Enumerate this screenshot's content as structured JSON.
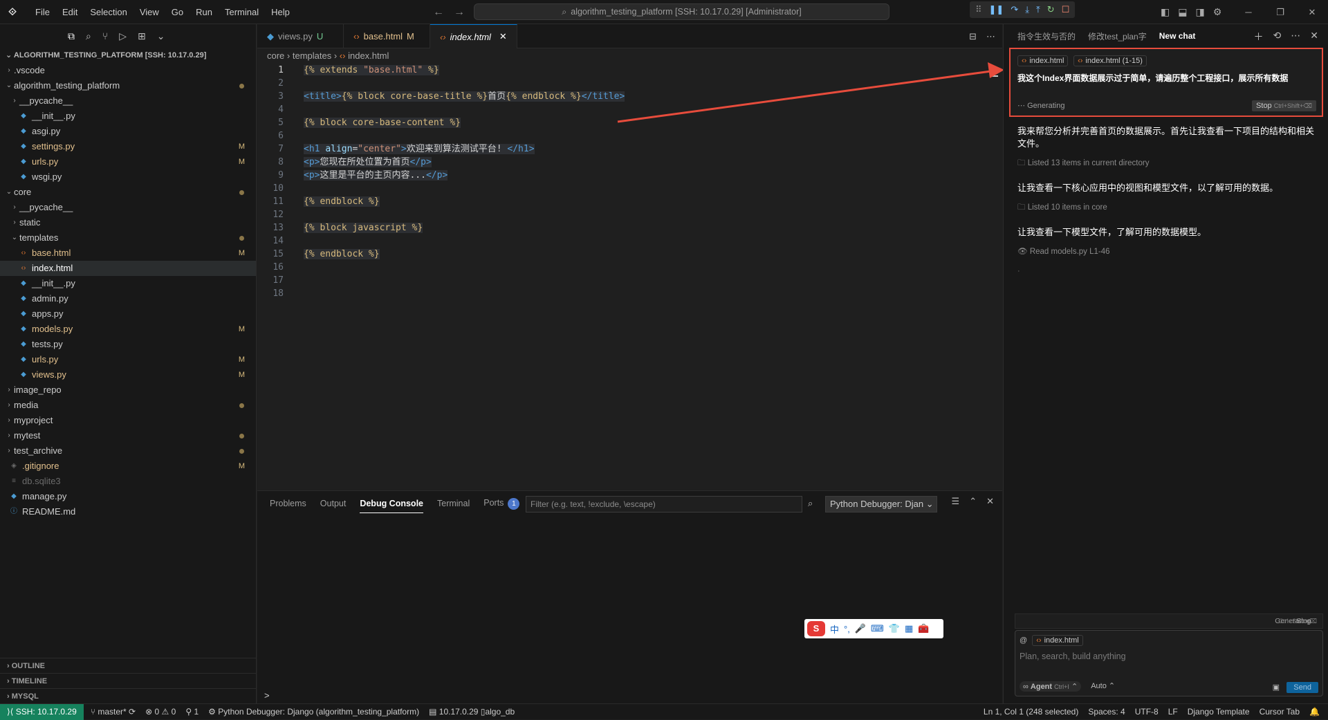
{
  "titlebar": {
    "menu": [
      "File",
      "Edit",
      "Selection",
      "View",
      "Go",
      "Run",
      "Terminal",
      "Help"
    ],
    "command_center": "algorithm_testing_platform [SSH: 10.17.0.29] [Administrator]"
  },
  "explorer": {
    "header": "ALGORITHM_TESTING_PLATFORM [SSH: 10.17.0.29]",
    "items": [
      {
        "label": ".vscode",
        "depth": 1,
        "type": "folder",
        "collapsed": true
      },
      {
        "label": "algorithm_testing_platform",
        "depth": 1,
        "type": "folder",
        "collapsed": false,
        "status": "dot"
      },
      {
        "label": "__pycache__",
        "depth": 2,
        "type": "folder",
        "collapsed": true
      },
      {
        "label": "__init__.py",
        "depth": 2,
        "type": "py"
      },
      {
        "label": "asgi.py",
        "depth": 2,
        "type": "py"
      },
      {
        "label": "settings.py",
        "depth": 2,
        "type": "py",
        "status": "M"
      },
      {
        "label": "urls.py",
        "depth": 2,
        "type": "py",
        "status": "M"
      },
      {
        "label": "wsgi.py",
        "depth": 2,
        "type": "py"
      },
      {
        "label": "core",
        "depth": 1,
        "type": "folder",
        "collapsed": false,
        "status": "dot"
      },
      {
        "label": "__pycache__",
        "depth": 2,
        "type": "folder",
        "collapsed": true
      },
      {
        "label": "static",
        "depth": 2,
        "type": "folder",
        "collapsed": true
      },
      {
        "label": "templates",
        "depth": 2,
        "type": "folder",
        "collapsed": false,
        "status": "dot"
      },
      {
        "label": "base.html",
        "depth": 3,
        "type": "html",
        "status": "M"
      },
      {
        "label": "index.html",
        "depth": 3,
        "type": "html",
        "selected": true
      },
      {
        "label": "__init__.py",
        "depth": 2,
        "type": "py"
      },
      {
        "label": "admin.py",
        "depth": 2,
        "type": "py"
      },
      {
        "label": "apps.py",
        "depth": 2,
        "type": "py"
      },
      {
        "label": "models.py",
        "depth": 2,
        "type": "py",
        "status": "M"
      },
      {
        "label": "tests.py",
        "depth": 2,
        "type": "py"
      },
      {
        "label": "urls.py",
        "depth": 2,
        "type": "py",
        "status": "M"
      },
      {
        "label": "views.py",
        "depth": 2,
        "type": "py",
        "status": "M"
      },
      {
        "label": "image_repo",
        "depth": 1,
        "type": "folder",
        "collapsed": true
      },
      {
        "label": "media",
        "depth": 1,
        "type": "folder",
        "collapsed": true,
        "status": "dot"
      },
      {
        "label": "myproject",
        "depth": 1,
        "type": "folder",
        "collapsed": true
      },
      {
        "label": "mytest",
        "depth": 1,
        "type": "folder",
        "collapsed": true,
        "status": "dot"
      },
      {
        "label": "test_archive",
        "depth": 1,
        "type": "folder",
        "collapsed": true,
        "status": "dot"
      },
      {
        "label": ".gitignore",
        "depth": 0,
        "type": "git",
        "status": "M"
      },
      {
        "label": "db.sqlite3",
        "depth": 0,
        "type": "db",
        "dim": true
      },
      {
        "label": "manage.py",
        "depth": 0,
        "type": "py"
      },
      {
        "label": "README.md",
        "depth": 0,
        "type": "md"
      }
    ],
    "bottom_sections": [
      "OUTLINE",
      "TIMELINE",
      "MYSQL"
    ]
  },
  "editor": {
    "tabs": [
      {
        "label": "views.py",
        "status": "U",
        "icon": "python-icon"
      },
      {
        "label": "base.html",
        "status": "M",
        "icon": "html-icon"
      },
      {
        "label": "index.html",
        "status": "",
        "icon": "html-icon",
        "active": true
      }
    ],
    "breadcrumb": [
      "core",
      "templates",
      "index.html"
    ],
    "current_line": 1,
    "lines": [
      "{% extends \"base.html\" %}",
      "",
      "<title>{% block core-base-title %}首页{% endblock %}</title>",
      "",
      "{% block core-base-content %}",
      "",
      "<h1 align=\"center\">欢迎来到算法测试平台! </h1>",
      "<p>您现在所处位置为首页</p>",
      "<p>这里是平台的主页内容...</p>",
      "",
      "{% endblock %}",
      "",
      "{% block javascript %}",
      "",
      "{% endblock %}",
      "",
      "",
      ""
    ]
  },
  "panel": {
    "tabs": [
      "Problems",
      "Output",
      "Debug Console",
      "Terminal",
      "Ports"
    ],
    "active_tab": "Debug Console",
    "ports_badge": "1",
    "filter_placeholder": "Filter (e.g. text, !exclude, \\escape)",
    "debugger_select": "Python Debugger: Djan",
    "prompt": ">"
  },
  "ime": {
    "s": "S",
    "lang": "中",
    "punct": "°,"
  },
  "chat": {
    "tabs": [
      "指令生效与否的",
      "修改test_plan字",
      "New chat"
    ],
    "active_tab": "New chat",
    "context_chips": [
      "index.html",
      "index.html (1-15)"
    ],
    "user_message": "我这个Index界面数据展示过于简单，请遍历整个工程接口，展示所有数据",
    "generating": "Generating",
    "stop": "Stop",
    "stop_shortcut": "Ctrl+Shift+⌫",
    "responses": [
      {
        "kind": "text",
        "text": "我来帮您分析并完善首页的数据展示。首先让我查看一下项目的结构和相关文件。"
      },
      {
        "kind": "step",
        "icon": "folder-icon",
        "text": "Listed 13 items in current directory"
      },
      {
        "kind": "text",
        "text": "让我查看一下核心应用中的视图和模型文件，以了解可用的数据。"
      },
      {
        "kind": "step",
        "icon": "folder-icon",
        "text": "Listed 10 items in core"
      },
      {
        "kind": "text",
        "text": "让我查看一下模型文件，了解可用的数据模型。"
      },
      {
        "kind": "step",
        "icon": "eye-icon",
        "text": "Read models.py L1-46"
      }
    ],
    "gen_bar": "Generating...",
    "gen_bar_stop": "Stop",
    "mention_chip": "index.html",
    "input_placeholder": "Plan, search, build anything",
    "agent_label": "Agent",
    "agent_shortcut": "Ctrl+I",
    "model_label": "Auto",
    "send_label": "Send"
  },
  "statusbar": {
    "remote": "SSH: 10.17.0.29",
    "branch": "master*",
    "errors": "0",
    "warnings": "0",
    "ports": "1",
    "debugger": "Python Debugger: Django (algorithm_testing_platform)",
    "db_host": "10.17.0.29",
    "db_name": "algo_db",
    "position": "Ln 1, Col 1 (248 selected)",
    "spaces": "Spaces: 4",
    "encoding": "UTF-8",
    "eol": "LF",
    "language": "Django Template",
    "tab_mode": "Cursor Tab"
  },
  "colors": {
    "accent": "#0078d4",
    "remote_bg": "#16825d",
    "highlight_border": "#e74c3c",
    "modified": "#e2c08d"
  }
}
